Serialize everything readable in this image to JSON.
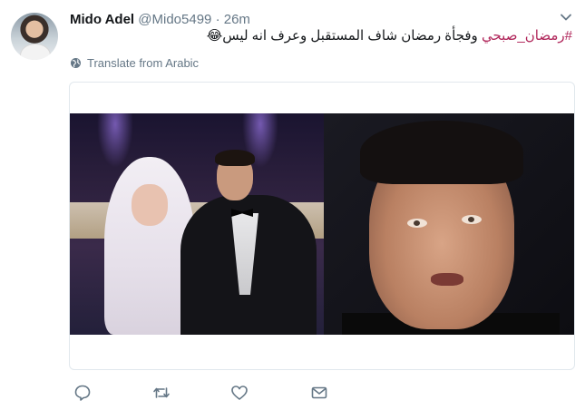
{
  "tweet": {
    "author_name": "Mido Adel",
    "handle": "@Mido5499",
    "separator": "·",
    "time": "26m",
    "hashtag": "#رمضان_صبحي",
    "text": " وفجأة رمضان شاف المستقبل وعرف انه ليس",
    "emoji": "😂",
    "translate_label": "Translate from Arabic"
  },
  "icons": {
    "menu": "chevron-down-icon",
    "translate": "globe-icon",
    "reply": "reply-icon",
    "retweet": "retweet-icon",
    "like": "heart-icon",
    "message": "envelope-icon"
  },
  "colors": {
    "hashtag": "#b0265a",
    "secondary_text": "#657786",
    "primary_text": "#14171a",
    "icon": "#657786"
  }
}
